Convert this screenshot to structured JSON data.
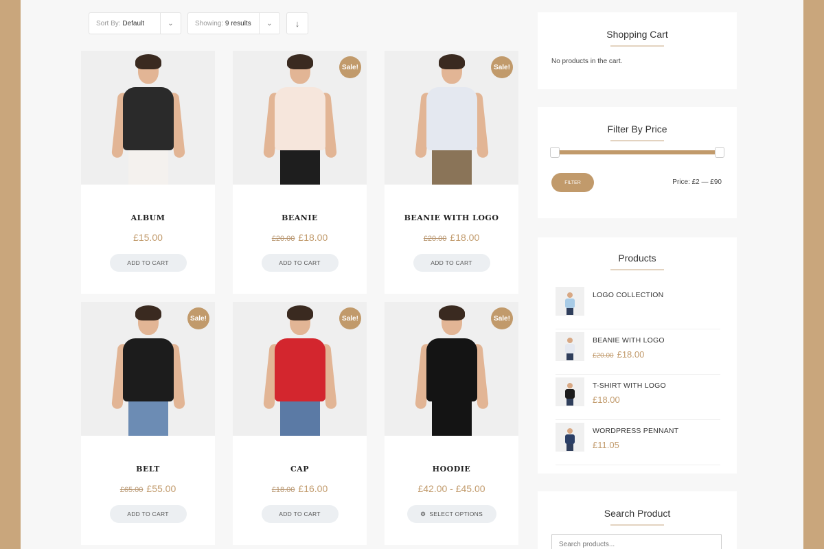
{
  "toolbar": {
    "sort_label": "Sort By:",
    "sort_value": "Default",
    "show_label": "Showing:",
    "show_value": "9 results",
    "direction_icon": "↓"
  },
  "products": [
    {
      "name": "ALBUM",
      "old_price": "",
      "price": "£15.00",
      "sale": false,
      "button": "ADD TO CART",
      "top_color": "#2a2a2a",
      "bottom_color": "#f4f1ee"
    },
    {
      "name": "BEANIE",
      "old_price": "£20.00",
      "price": "£18.00",
      "sale": true,
      "button": "ADD TO CART",
      "top_color": "#f6e6dc",
      "bottom_color": "#1e1e1e"
    },
    {
      "name": "BEANIE WITH LOGO",
      "old_price": "£20.00",
      "price": "£18.00",
      "sale": true,
      "button": "ADD TO CART",
      "top_color": "#e4e8f0",
      "bottom_color": "#8a7458"
    },
    {
      "name": "BELT",
      "old_price": "£65.00",
      "price": "£55.00",
      "sale": true,
      "button": "ADD TO CART",
      "top_color": "#1c1c1c",
      "bottom_color": "#6c8cb4"
    },
    {
      "name": "CAP",
      "old_price": "£18.00",
      "price": "£16.00",
      "sale": true,
      "button": "ADD TO CART",
      "top_color": "#d3262e",
      "bottom_color": "#5b7aa5"
    },
    {
      "name": "HOODIE",
      "old_price": "",
      "price": "£42.00 - £45.00",
      "sale": true,
      "button": "SELECT OPTIONS",
      "top_color": "#141414",
      "bottom_color": "#141414"
    }
  ],
  "sale_badge": "Sale!",
  "sidebar": {
    "cart_title": "Shopping Cart",
    "cart_empty": "No products in the cart.",
    "filter_title": "Filter By Price",
    "filter_button": "FILTER",
    "filter_range": "Price:  £2 — £90",
    "products_title": "Products",
    "product_list": [
      {
        "name": "LOGO COLLECTION",
        "old_price": "",
        "price": "",
        "color": "#a8cbe6"
      },
      {
        "name": "BEANIE WITH LOGO",
        "old_price": "£20.00",
        "price": "£18.00",
        "color": "#e4e8f0"
      },
      {
        "name": "T-SHIRT WITH LOGO",
        "old_price": "",
        "price": "£18.00",
        "color": "#1c1c1c"
      },
      {
        "name": "WORDPRESS PENNANT",
        "old_price": "",
        "price": "£11.05",
        "color": "#2b3f66"
      }
    ],
    "search_title": "Search Product",
    "search_placeholder": "Search products..."
  }
}
